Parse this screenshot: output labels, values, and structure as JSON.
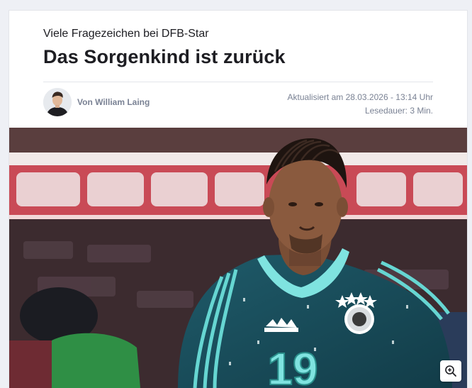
{
  "article": {
    "kicker": "Viele Fragezeichen bei DFB-Star",
    "headline": "Das Sorgenkind ist zurück",
    "author": "Von William Laing",
    "updated": "Aktualisiert am 28.03.2026 - 13:14 Uhr",
    "reading_time": "Lesedauer: 3 Min."
  },
  "hero": {
    "jersey_number": "19"
  },
  "icons": {
    "zoom": "zoom-in-icon"
  }
}
